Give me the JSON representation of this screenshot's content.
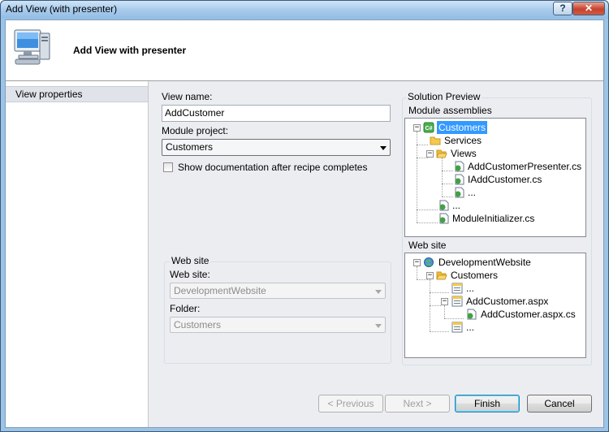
{
  "window": {
    "title": "Add View (with presenter)",
    "help_label": "?",
    "close_label": "✕"
  },
  "header": {
    "title": "Add View with presenter",
    "icon": "computer-icon"
  },
  "nav": {
    "items": [
      {
        "label": "View properties"
      }
    ]
  },
  "form": {
    "view_name_label": "View name:",
    "view_name_value": "AddCustomer",
    "module_project_label": "Module project:",
    "module_project_value": "Customers",
    "show_docs_label": "Show documentation after recipe completes",
    "show_docs_checked": false,
    "website_group_title": "Web site",
    "website_label": "Web site:",
    "website_value": "DevelopmentWebsite",
    "folder_label": "Folder:",
    "folder_value": "Customers"
  },
  "preview": {
    "title": "Solution Preview",
    "module_assemblies_label": "Module assemblies",
    "module_tree": [
      {
        "label": "Customers",
        "icon": "csharp-project-icon",
        "selected": true
      },
      {
        "label": "Services",
        "icon": "folder-icon"
      },
      {
        "label": "Views",
        "icon": "folder-open-icon"
      },
      {
        "label": "AddCustomerPresenter.cs",
        "icon": "csharp-file-icon"
      },
      {
        "label": "IAddCustomer.cs",
        "icon": "csharp-file-icon"
      },
      {
        "label": "...",
        "icon": "csharp-file-icon"
      },
      {
        "label": "...",
        "icon": "csharp-file-icon"
      },
      {
        "label": "ModuleInitializer.cs",
        "icon": "csharp-file-icon"
      }
    ],
    "website_label": "Web site",
    "website_tree": [
      {
        "label": "DevelopmentWebsite",
        "icon": "website-icon"
      },
      {
        "label": "Customers",
        "icon": "folder-open-icon"
      },
      {
        "label": "...",
        "icon": "aspx-file-icon"
      },
      {
        "label": "AddCustomer.aspx",
        "icon": "aspx-file-icon"
      },
      {
        "label": "AddCustomer.aspx.cs",
        "icon": "csharp-file-icon"
      },
      {
        "label": "...",
        "icon": "aspx-file-icon"
      }
    ]
  },
  "buttons": {
    "previous": "< Previous",
    "next": "Next >",
    "finish": "Finish",
    "cancel": "Cancel"
  }
}
